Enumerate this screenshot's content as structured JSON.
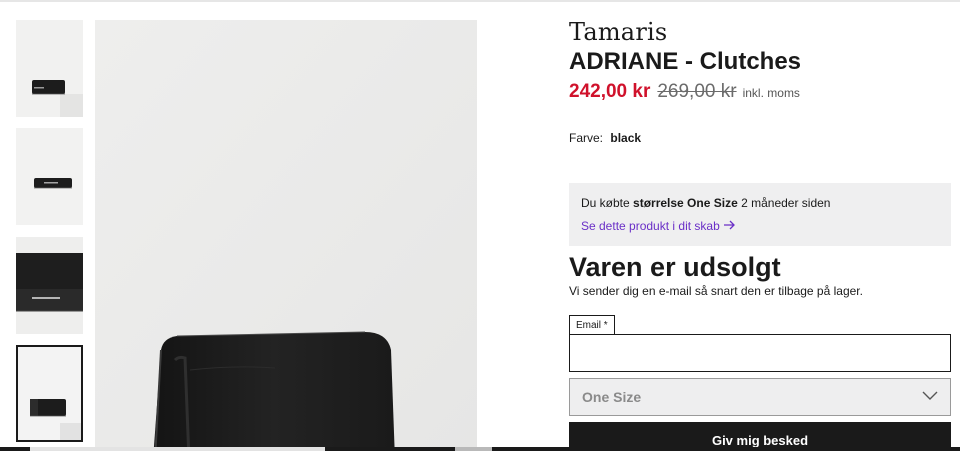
{
  "product": {
    "brand": "Tamaris",
    "name": "ADRIANE - Clutches",
    "price_current": "242,00 kr",
    "price_old": "269,00 kr",
    "vat_note": "inkl. moms"
  },
  "color": {
    "label": "Farve:",
    "value": "black"
  },
  "owned": {
    "prefix": "Du købte",
    "size_label": "størrelse One Size",
    "suffix": "2 måneder siden",
    "link_text": "Se dette produkt i dit skab",
    "link_icon": "arrow-right-icon"
  },
  "soldout": {
    "title": "Varen er udsolgt",
    "subtitle": "Vi sender dig en e-mail så snart den er tilbage på lager."
  },
  "email": {
    "label": "Email *",
    "value": "",
    "placeholder": ""
  },
  "size": {
    "selected": "One Size",
    "icon": "chevron-down-icon"
  },
  "notify_button": {
    "label": "Giv mig besked"
  },
  "colors": {
    "price_red": "#d0112b",
    "link_purple": "#6a2fc7",
    "button_black": "#1a1a1a",
    "info_box_gray": "#efeff0"
  }
}
